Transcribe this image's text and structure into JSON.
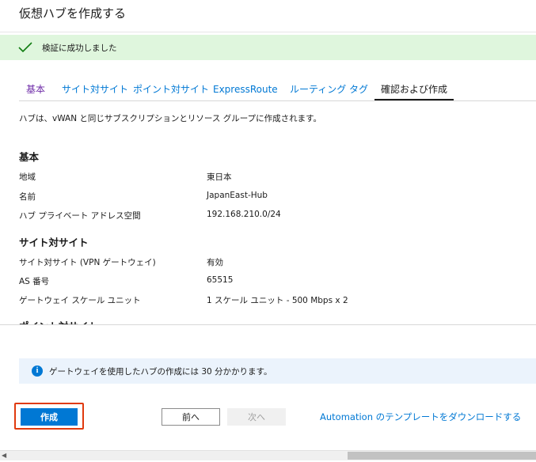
{
  "page": {
    "title": "仮想ハブを作成する"
  },
  "validation": {
    "message": "検証に成功しました",
    "color": "#dff6dd"
  },
  "tabs": [
    {
      "label": "基本",
      "state": "visited"
    },
    {
      "label": "サイト対サイト",
      "state": "normal"
    },
    {
      "label": "ポイント対サイト",
      "state": "normal"
    },
    {
      "label": "ExpressRoute",
      "state": "normal"
    },
    {
      "label": "ルーティング",
      "state": "normal"
    },
    {
      "label": "タグ",
      "state": "normal"
    },
    {
      "label": "確認および作成",
      "state": "active"
    }
  ],
  "summary": {
    "description": "ハブは、vWAN と同じサブスクリプションとリソース グループに作成されます。",
    "sections": [
      {
        "title": "基本",
        "rows": [
          {
            "label": "地域",
            "value": "東日本"
          },
          {
            "label": "名前",
            "value": "JapanEast-Hub"
          },
          {
            "label": "ハブ プライベート アドレス空間",
            "value": "192.168.210.0/24"
          }
        ]
      },
      {
        "title": "サイト対サイト",
        "rows": [
          {
            "label": "サイト対サイト (VPN ゲートウェイ)",
            "value": "有効"
          },
          {
            "label": "AS 番号",
            "value": "65515"
          },
          {
            "label": "ゲートウェイ スケール ユニット",
            "value": "1 スケール ユニット - 500 Mbps x 2"
          }
        ]
      },
      {
        "title": "ポイント対サイト",
        "rows": []
      }
    ]
  },
  "info": {
    "message": "ゲートウェイを使用したハブの作成には 30 分かかります。",
    "icon": "info-icon"
  },
  "footer": {
    "create_label": "作成",
    "prev_label": "前へ",
    "next_label": "次へ",
    "automation_label": "Automation のテンプレートをダウンロードする"
  },
  "colors": {
    "accent": "#0078d4",
    "highlight": "#e03a0e",
    "visited": "#6f2da8"
  }
}
